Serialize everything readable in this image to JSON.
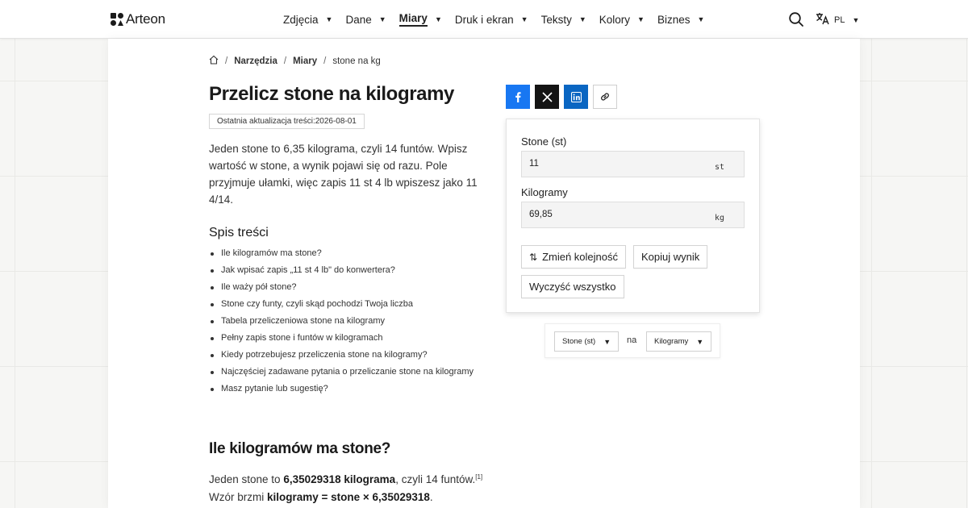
{
  "header": {
    "logo_text": "Arteon",
    "nav": [
      {
        "label": "Zdjęcia",
        "active": false
      },
      {
        "label": "Dane",
        "active": false
      },
      {
        "label": "Miary",
        "active": true
      },
      {
        "label": "Druk i ekran",
        "active": false
      },
      {
        "label": "Teksty",
        "active": false
      },
      {
        "label": "Kolory",
        "active": false
      },
      {
        "label": "Biznes",
        "active": false
      }
    ],
    "language": "PL",
    "search_icon": "search-icon",
    "translate_icon": "translate-icon"
  },
  "breadcrumb": {
    "items": [
      "Narzędzia",
      "Miary",
      "stone na kg"
    ]
  },
  "article": {
    "title": "Przelicz stone na kilogramy",
    "updated": "Ostatnia aktualizacja treści:2026-08-01",
    "intro": "Jeden stone to 6,35 kilograma, czyli 14 funtów. Wpisz wartość w stone, a wynik pojawi się od razu. Pole przyjmuje ułamki, więc zapis 11 st 4 lb wpiszesz jako 11 4/14.",
    "toc_title": "Spis treści",
    "toc": [
      "Ile kilogramów ma stone?",
      "Jak wpisać zapis „11 st 4 lb\" do konwertera?",
      "Ile waży pół stone?",
      "Stone czy funty, czyli skąd pochodzi Twoja liczba",
      "Tabela przeliczeniowa stone na kilogramy",
      "Pełny zapis stone i funtów w kilogramach",
      "Kiedy potrzebujesz przeliczenia stone na kilogramy?",
      "Najczęściej zadawane pytania o przeliczanie stone na kilogramy",
      "Masz pytanie lub sugestię?"
    ],
    "section_title": "Ile kilogramów ma stone?",
    "section_p1_a": "Jeden stone to ",
    "section_p1_b": "6,35029318 kilograma",
    "section_p1_c": ", czyli 14 funtów.",
    "section_p1_ref": "[1]",
    "section_p2_a": "Wzór brzmi ",
    "section_p2_b": "kilogramy = stone × 6,35029318",
    "section_p2_c": "."
  },
  "share": {
    "facebook": "facebook-icon",
    "x": "x-icon",
    "linkedin": "linkedin-icon",
    "link": "link-icon"
  },
  "converter": {
    "from_label": "Stone (st)",
    "from_value": "11",
    "from_unit": "st",
    "to_label": "Kilogramy",
    "to_value": "69,85",
    "to_unit": "kg",
    "swap_label": "Zmień kolejność",
    "copy_label": "Kopiuj wynik",
    "clear_label": "Wyczyść wszystko"
  },
  "unit_select": {
    "from": "Stone (st)",
    "connector": "na",
    "to": "Kilogramy"
  },
  "colors": {
    "facebook": "#1877f2",
    "x": "#141414",
    "linkedin": "#0a66c2"
  }
}
